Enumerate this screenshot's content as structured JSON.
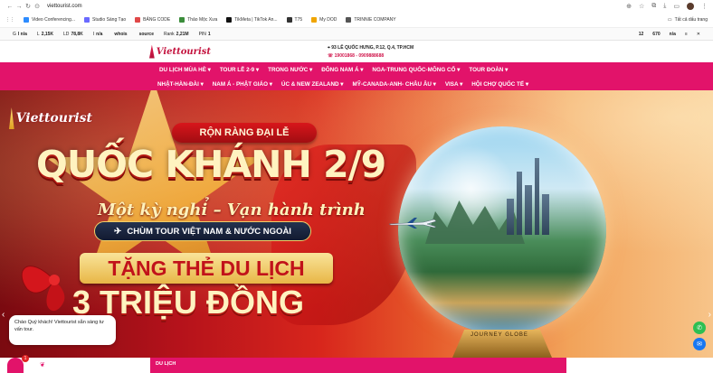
{
  "browser": {
    "url": "viettourist.com",
    "bookmarks": [
      {
        "label": "Video Conferencing...",
        "color": "#2d8cff"
      },
      {
        "label": "Studio Sáng Tạo",
        "color": "#6a6aff"
      },
      {
        "label": "BẢNG CODE",
        "color": "#e04848"
      },
      {
        "label": "Thảo Mộc Xưa",
        "color": "#3b8d3b"
      },
      {
        "label": "TikMeta | TikTok An...",
        "color": "#111111"
      },
      {
        "label": "T75",
        "color": "#333333"
      },
      {
        "label": "My DOD",
        "color": "#f0a500"
      },
      {
        "label": "TRINNIE COMPANY",
        "color": "#555555"
      }
    ],
    "bookmarks_right": "Tất cả dấu trang"
  },
  "seo_bar": {
    "items": [
      {
        "key": "G",
        "value": "I n/a"
      },
      {
        "key": "L",
        "value": "2,15K"
      },
      {
        "key": "LD",
        "value": "78,8K"
      },
      {
        "key": "I",
        "value": "n/a"
      },
      {
        "key": "",
        "value": "whois"
      },
      {
        "key": "",
        "value": "source"
      },
      {
        "key": "Rank",
        "value": "2,21M"
      },
      {
        "key": "PIN",
        "value": "1"
      }
    ],
    "right_items": [
      "12",
      "670",
      "n/a"
    ]
  },
  "header": {
    "logo_text": "Viettourist",
    "address": "93 LÊ QUỐC HƯNG, P.12, Q.4, TP.HCM",
    "phone": "19001868 - 0909888688"
  },
  "nav": {
    "row1": [
      "DU LỊCH MÙA HÈ",
      "TOUR LỄ 2-9",
      "TRONG NƯỚC",
      "ĐÔNG NAM Á",
      "NGA-TRUNG QUỐC-MÔNG CỔ",
      "TOUR ĐOÀN"
    ],
    "row2": [
      "NHẬT-HÀN-ĐÀI",
      "NAM Á - PHẬT GIÁO",
      "ÚC & NEW ZEALAND",
      "MỸ-CANADA-ANH- CHÂU ÂU",
      "VISA",
      "HỘI CHỢ QUỐC TẾ"
    ]
  },
  "hero": {
    "logo_text": "Viettourist",
    "pill": "RỘN RÀNG ĐẠI LỄ",
    "title": "QUỐC KHÁNH 2/9",
    "subtitle": "Một kỳ nghỉ – Vạn hành trình",
    "banner": "CHÙM TOUR VIỆT NAM & NƯỚC NGOÀI",
    "ribbon": "TẶNG THẺ DU LỊCH",
    "amount": "3 TRIỆU ĐỒNG",
    "stand_text": "JOURNEY GLOBE"
  },
  "chat": {
    "message": "Chào Quý khách! Viettourist sẵn sàng tư vấn tour.",
    "badge": "1"
  },
  "bottom": {
    "label": "DU LỊCH"
  }
}
